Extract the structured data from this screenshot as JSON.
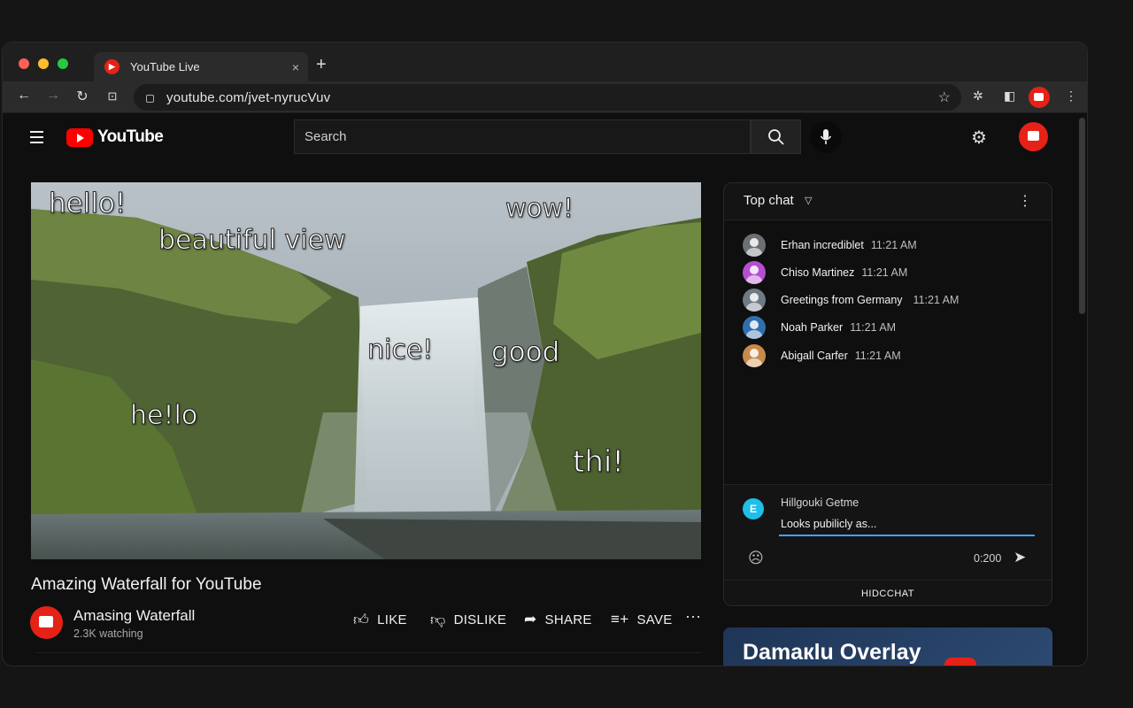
{
  "browser": {
    "tab_title": "YouTube Live",
    "tab_close": "×",
    "new_tab": "+",
    "url": "youtube.com/jvet-nyrucVuv",
    "traffic_lights": [
      "#ff5f57",
      "#febc2e",
      "#28c840"
    ]
  },
  "header": {
    "logo_text": "YouTube",
    "search_placeholder": "Search"
  },
  "video": {
    "overlays": [
      {
        "text": "hello!"
      },
      {
        "text": "wow!"
      },
      {
        "text": "beautiful view"
      },
      {
        "text": "nice!"
      },
      {
        "text": "good"
      },
      {
        "text": "he!lo"
      },
      {
        "text": "thi!"
      }
    ],
    "title": "Amazing Waterfall for YouTube",
    "channel_name": "Amasing Waterfall",
    "watching": "2.3K watching",
    "actions": {
      "like": "LIKE",
      "dislike": "DISLIKE",
      "share": "SHARE",
      "save": "SAVE"
    }
  },
  "chat": {
    "title": "Top chat",
    "messages": [
      {
        "author": "Erhan incrediblet",
        "time": "11:21 AM",
        "avatar_color": "#6b6e72"
      },
      {
        "author": "Chiso Martinez",
        "time": "11:21 AM",
        "avatar_color": "#b44fd0"
      },
      {
        "author": "Greetings from Germany",
        "time": "11:21 AM",
        "avatar_color": "#6f7a85"
      },
      {
        "author": "Noah Parker",
        "time": "11:21 AM",
        "avatar_color": "#2f6fae"
      },
      {
        "author": "Abigall Carfer",
        "time": "11:21 AM",
        "avatar_color": "#c88a4a"
      }
    ],
    "me": {
      "initial": "E",
      "name": "Hillgouki Getme",
      "draft": "Looks pubilicly as...",
      "counter": "0:200"
    },
    "hide_label": "HIDCCHAT"
  },
  "promo": {
    "title": "Damaкlu Overlay"
  }
}
